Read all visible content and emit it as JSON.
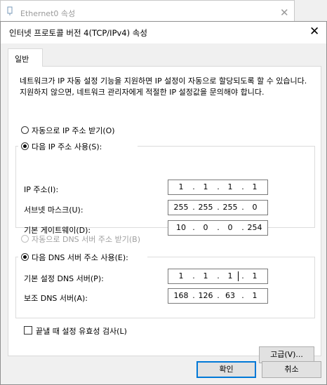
{
  "background_window": {
    "title": "Ethernet0 속성",
    "close": "✕"
  },
  "dialog": {
    "title": "인터넷 프로토콜 버전 4(TCP/IPv4) 속성",
    "close": "✕",
    "tab": "일반",
    "description": "네트워크가 IP 자동 설정 기능을 지원하면 IP 설정이 자동으로 할당되도록 할 수 있습니다. 지원하지 않으면, 네트워크 관리자에게 적절한 IP 설정값을 문의해야 합니다.",
    "ip_auto_label": "자동으로 IP 주소 받기(O)",
    "ip_manual_label": "다음 IP 주소 사용(S):",
    "ip_mode": "manual",
    "ip_fields": [
      {
        "label": "IP 주소(I):",
        "octets": [
          "1",
          "1",
          "1",
          "1"
        ]
      },
      {
        "label": "서브넷 마스크(U):",
        "octets": [
          "255",
          "255",
          "255",
          "0"
        ]
      },
      {
        "label": "기본 게이트웨이(D):",
        "octets": [
          "10",
          "0",
          "0",
          "254"
        ]
      }
    ],
    "dns_auto_label": "자동으로 DNS 서버 주소 받기(B)",
    "dns_manual_label": "다음 DNS 서버 주소 사용(E):",
    "dns_mode": "manual",
    "dns_fields": [
      {
        "label": "기본 설정 DNS 서버(P):",
        "octets": [
          "1",
          "1",
          "1",
          "1"
        ]
      },
      {
        "label": "보조 DNS 서버(A):",
        "octets": [
          "168",
          "126",
          "63",
          "1"
        ]
      }
    ],
    "validate_label": "끝낼 때 설정 유효성 검사(L)",
    "validate_checked": false,
    "advanced_button": "고급(V)...",
    "ok_button": "확인",
    "cancel_button": "취소",
    "accent_color": "#0078d7"
  }
}
